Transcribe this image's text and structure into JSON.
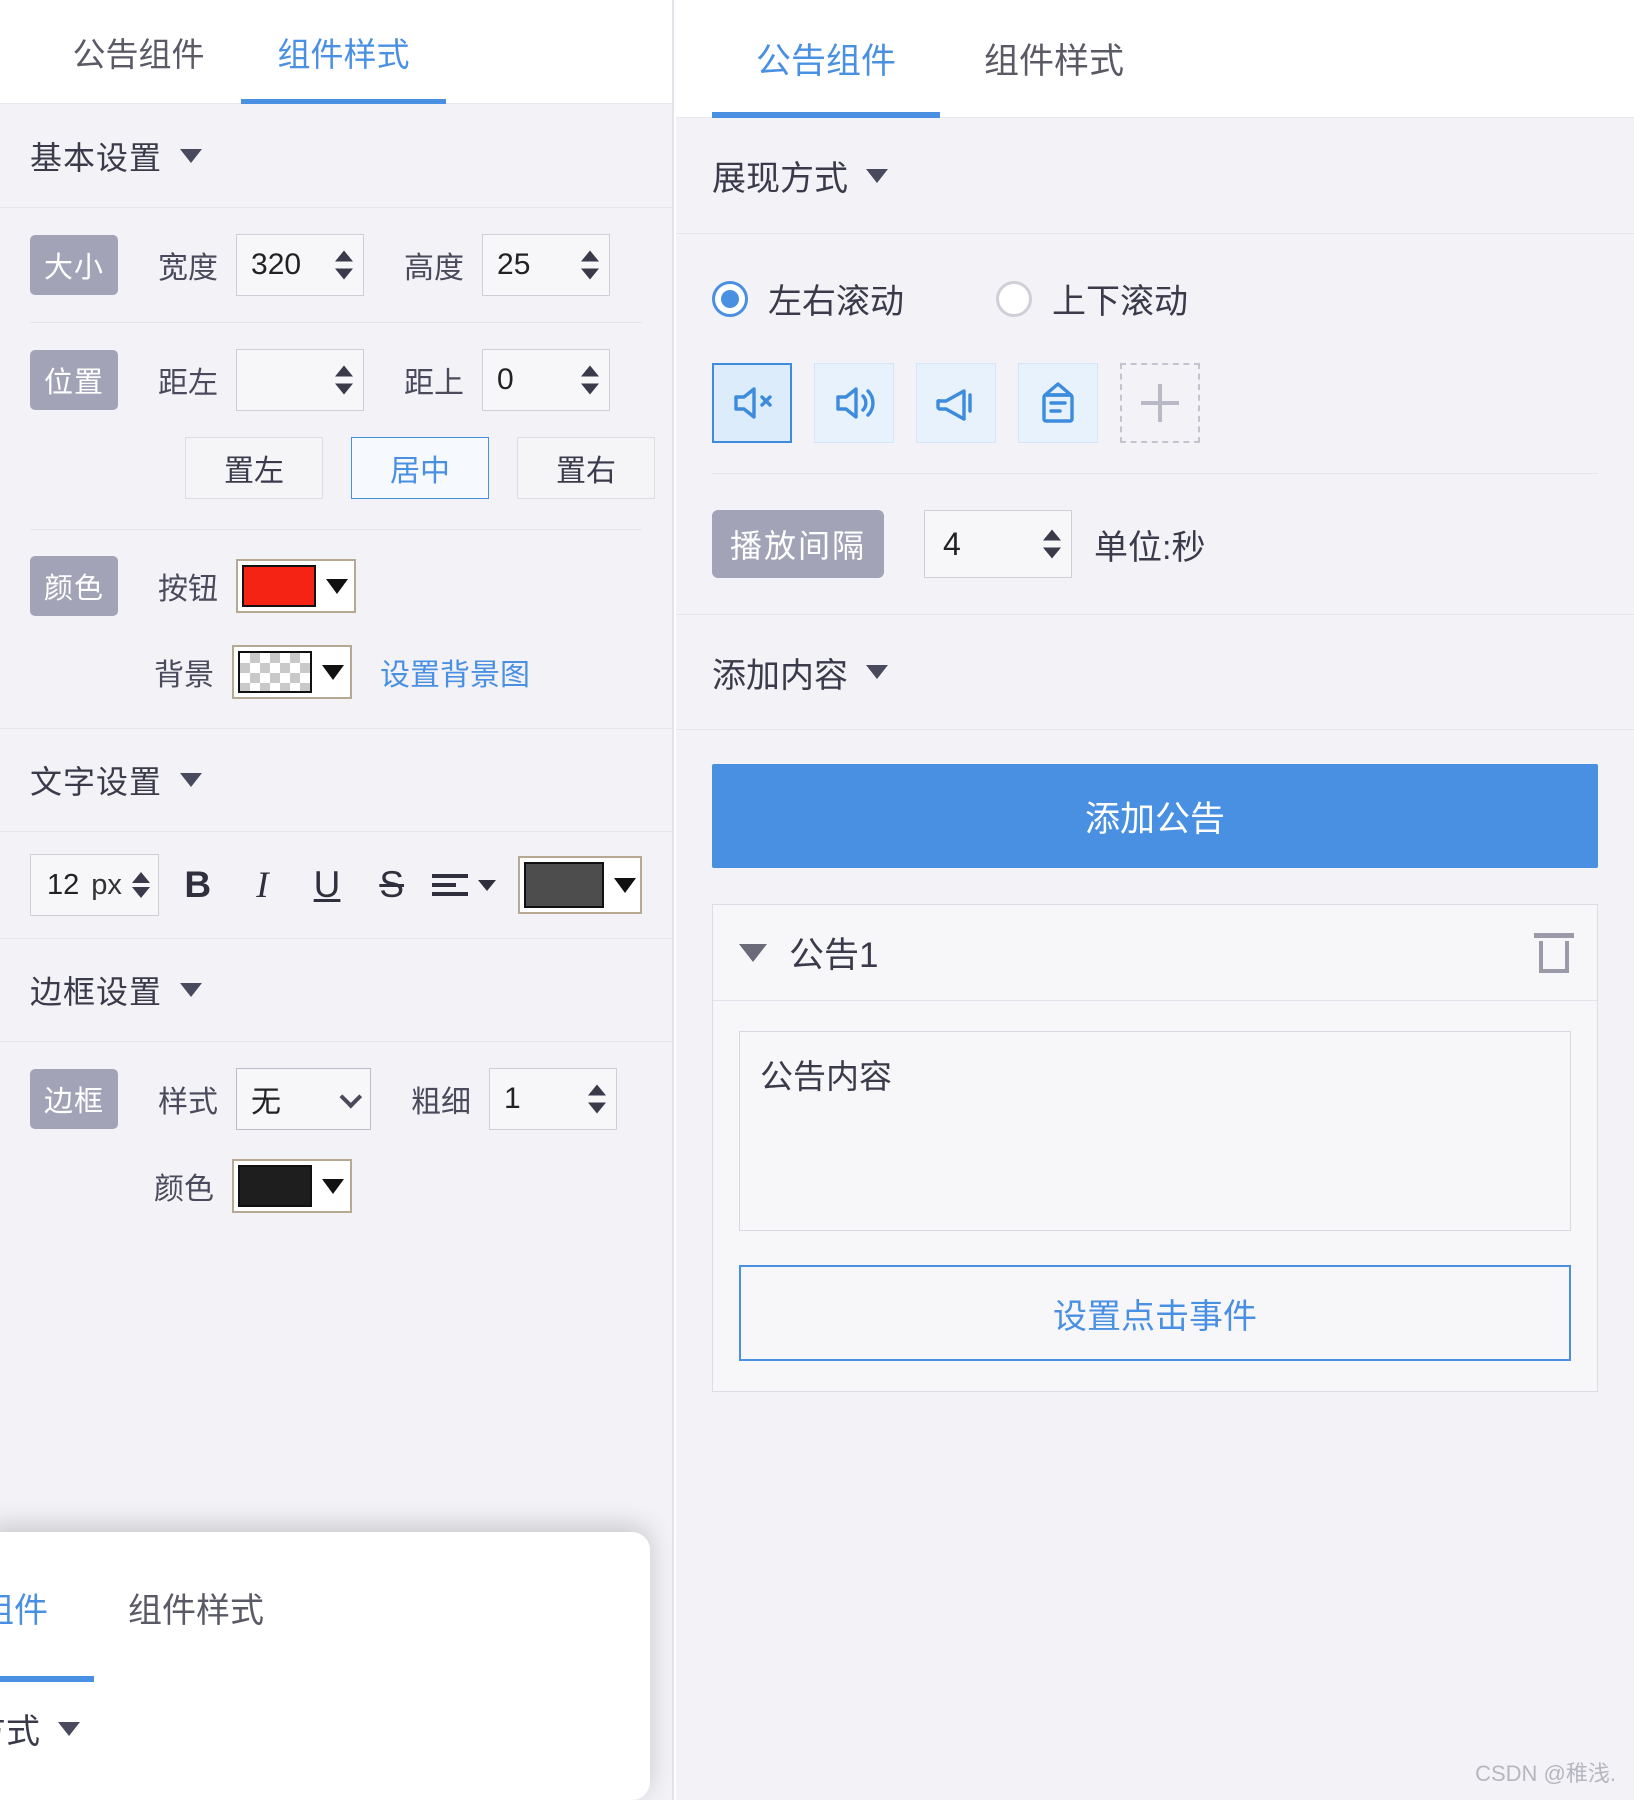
{
  "left_panel": {
    "tabs": [
      {
        "label": "公告组件",
        "active": false
      },
      {
        "label": "组件样式",
        "active": true
      }
    ],
    "basic_section": {
      "title": "基本设置",
      "size": {
        "badge": "大小",
        "width_label": "宽度",
        "width_value": "320",
        "height_label": "高度",
        "height_value": "25"
      },
      "position": {
        "badge": "位置",
        "left_label": "距左",
        "left_value": "",
        "top_label": "距上",
        "top_value": "0",
        "align_buttons": [
          {
            "label": "置左",
            "selected": false
          },
          {
            "label": "居中",
            "selected": true
          },
          {
            "label": "置右",
            "selected": false
          }
        ]
      },
      "color": {
        "badge": "颜色",
        "button_label": "按钮",
        "button_color": "#F42314",
        "background_label": "背景",
        "background_color": "transparent",
        "background_image_link": "设置背景图"
      }
    },
    "text_section": {
      "title": "文字设置",
      "font_size": "12",
      "font_size_unit": "px",
      "bold": "B",
      "italic": "I",
      "underline": "U",
      "strikethrough": "S",
      "text_color": "#4D4D4D"
    },
    "border_section": {
      "title": "边框设置",
      "badge": "边框",
      "style_label": "样式",
      "style_value": "无",
      "width_label": "粗细",
      "width_value": "1",
      "color_label": "颜色",
      "color_value": "#1E1E1E"
    },
    "float_panel": {
      "tabs": [
        {
          "label": "组件",
          "active": true
        },
        {
          "label": "组件样式",
          "active": false
        }
      ],
      "section_label": "方式"
    }
  },
  "right_panel": {
    "tabs": [
      {
        "label": "公告组件",
        "active": true
      },
      {
        "label": "组件样式",
        "active": false
      }
    ],
    "display_section": {
      "title": "展现方式",
      "radios": [
        {
          "label": "左右滚动",
          "checked": true
        },
        {
          "label": "上下滚动",
          "checked": false
        }
      ],
      "icons": [
        {
          "name": "speaker-mute-icon",
          "selected": true
        },
        {
          "name": "speaker-volume-icon",
          "selected": false
        },
        {
          "name": "megaphone-icon",
          "selected": false
        },
        {
          "name": "notice-board-icon",
          "selected": false
        },
        {
          "name": "add-plus-icon",
          "selected": false
        }
      ],
      "interval": {
        "badge": "播放间隔",
        "value": "4",
        "unit": "单位:秒"
      }
    },
    "content_section": {
      "title": "添加内容",
      "add_button": "添加公告",
      "announcements": [
        {
          "title": "公告1",
          "content_placeholder": "公告内容",
          "content_value": "",
          "event_button": "设置点击事件"
        }
      ]
    }
  },
  "watermark": "CSDN @稚浅."
}
